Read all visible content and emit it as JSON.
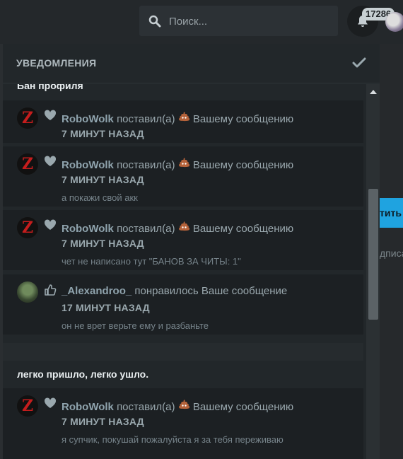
{
  "topbar": {
    "search_placeholder": "Поиск...",
    "notification_count": "17286"
  },
  "background": {
    "button_fragment": "тить",
    "text_fragment": "дписа"
  },
  "panel": {
    "title": "УВЕДОМЛЕНИЯ",
    "groups": [
      {
        "title": "Бан профиля",
        "items": [
          {
            "user": "RoboWolk",
            "action": "поставил(а)",
            "target": "Вашему сообщению",
            "time": "7 МИНУТ НАЗАД",
            "snippet": "",
            "reaction_icon": "heart-icon",
            "emoji": "poop-emoji"
          },
          {
            "user": "RoboWolk",
            "action": "поставил(а)",
            "target": "Вашему сообщению",
            "time": "7 МИНУТ НАЗАД",
            "snippet": "а покажи свой акк",
            "reaction_icon": "heart-icon",
            "emoji": "poop-emoji"
          },
          {
            "user": "RoboWolk",
            "action": "поставил(а)",
            "target": "Вашему сообщению",
            "time": "7 МИНУТ НАЗАД",
            "snippet": "чет не написано тут \"БАНОВ ЗА ЧИТЫ: 1\"",
            "reaction_icon": "heart-icon",
            "emoji": "poop-emoji"
          },
          {
            "user": "_Alexandroo_",
            "action": "понравилось Ваше сообщение",
            "target": "",
            "time": "17 МИНУТ НАЗАД",
            "snippet": "он не врет верьте ему и разбаньте",
            "reaction_icon": "thumbs-up-icon",
            "emoji": ""
          }
        ]
      },
      {
        "title": "легко пришло, легко ушло.",
        "items": [
          {
            "user": "RoboWolk",
            "action": "поставил(а)",
            "target": "Вашему сообщению",
            "time": "7 МИНУТ НАЗАД",
            "snippet": "я супчик, покушай пожалуйста я за тебя переживаю",
            "reaction_icon": "heart-icon",
            "emoji": "poop-emoji"
          }
        ]
      }
    ]
  },
  "colors": {
    "accent": "#1fa3e0",
    "panel_bg": "#22272a",
    "item_bg": "#1c2023",
    "username": "#8fa3ad"
  }
}
